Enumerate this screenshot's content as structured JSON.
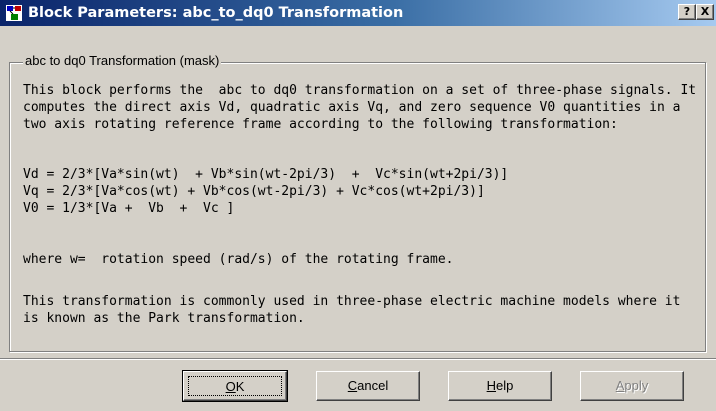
{
  "window": {
    "title": "Block Parameters: abc_to_dq0 Transformation",
    "help_button": "?",
    "close_button": "X"
  },
  "group": {
    "label": "abc to dq0 Transformation (mask)"
  },
  "description": {
    "paragraph1": "This block performs the  abc to dq0 transformation on a set of three-phase signals. It\ncomputes the direct axis Vd, quadratic axis Vq, and zero sequence V0 quantities in a\ntwo axis rotating reference frame according to the following transformation:",
    "equations": "Vd = 2/3*[Va*sin(wt)  + Vb*sin(wt-2pi/3)  +  Vc*sin(wt+2pi/3)]\nVq = 2/3*[Va*cos(wt) + Vb*cos(wt-2pi/3) + Vc*cos(wt+2pi/3)]\nV0 = 1/3*[Va +  Vb  +  Vc ]",
    "where": "where w=  rotation speed (rad/s) of the rotating frame.",
    "paragraph2": "This transformation is commonly used in three-phase electric machine models where it\nis known as the Park transformation."
  },
  "buttons": {
    "ok": {
      "mnemonic": "O",
      "rest": "K"
    },
    "cancel": {
      "mnemonic": "C",
      "rest": "ancel"
    },
    "help": {
      "mnemonic": "H",
      "rest": "elp"
    },
    "apply": {
      "mnemonic": "A",
      "rest": "pply"
    }
  },
  "colors": {
    "titlebar_start": "#0a246a",
    "titlebar_end": "#a6caf0",
    "face": "#d4d0c8"
  },
  "icons": {
    "app": "simulink-block-icon",
    "help": "question-mark-icon",
    "close": "close-icon"
  }
}
